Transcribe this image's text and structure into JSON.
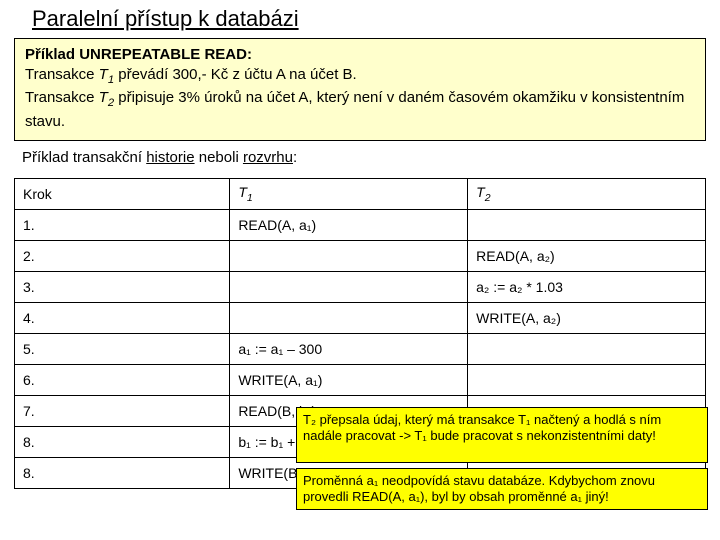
{
  "title": "Paralelní přístup k databázi",
  "example": {
    "lead": "Příklad UNREPEATABLE READ:",
    "line1a": "Transakce ",
    "line1b": " převádí 300,- Kč z účtu A na účet B.",
    "line2a": "Transakce ",
    "line2b": " připisuje 3% úroků na účet A, který není v daném časovém okamžiku v konsistentním stavu.",
    "t1": "T",
    "t1s": "1",
    "t2": "T",
    "t2s": "2"
  },
  "history_label_a": "Příklad transakční ",
  "history_label_b": "historie",
  "history_label_c": " neboli ",
  "history_label_d": "rozvrhu",
  "history_label_e": ":",
  "table": {
    "headers": {
      "step": "Krok",
      "t1": "T",
      "t1s": "1",
      "t2": "T",
      "t2s": "2"
    },
    "rows": [
      {
        "step": "1.",
        "t1": "READ(A, a₁)",
        "t2": ""
      },
      {
        "step": "2.",
        "t1": "",
        "t2": "READ(A, a₂)"
      },
      {
        "step": "3.",
        "t1": "",
        "t2": "a₂ := a₂ * 1.03"
      },
      {
        "step": "4.",
        "t1": "",
        "t2": "WRITE(A, a₂)"
      },
      {
        "step": "5.",
        "t1": "a₁ := a₁ – 300",
        "t2": ""
      },
      {
        "step": "6.",
        "t1": "WRITE(A, a₁)",
        "t2": ""
      },
      {
        "step": "7.",
        "t1": "READ(B, b₁)",
        "t2": ""
      },
      {
        "step": "8.",
        "t1": "b₁ := b₁ + 300",
        "t2": ""
      },
      {
        "step": "8.",
        "t1": "WRITE(B, b₁)",
        "t2": ""
      }
    ]
  },
  "overlay1": "T₂ přepsala údaj, který má transakce T₁ načtený a hodlá s ním nadále pracovat -> T₁ bude pracovat s nekonzistentními daty!",
  "overlay2": "Proměnná a₁ neodpovídá stavu databáze. Kdybychom znovu provedli READ(A, a₁), byl by obsah proměnné a₁ jiný!"
}
